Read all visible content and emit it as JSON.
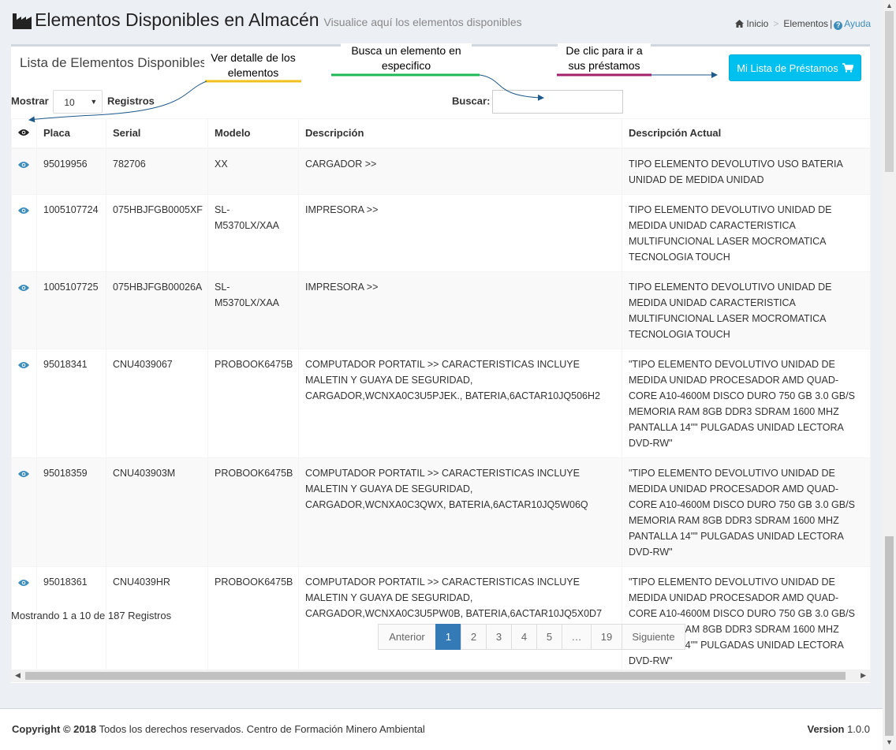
{
  "header": {
    "title": "Elementos Disponibles en Almacén",
    "subtitle": "Visualice aquí los elementos disponibles",
    "breadcrumb": {
      "home": "Inicio",
      "current": "Elementos",
      "help": "Ayuda"
    }
  },
  "box": {
    "title": "Lista de Elementos Disponibles",
    "loans_button": "Mi Lista de Préstamos"
  },
  "controls": {
    "show_label": "Mostrar",
    "show_value": "10",
    "records_label": "Registros",
    "search_label": "Buscar:",
    "search_value": ""
  },
  "table": {
    "columns": [
      "Placa",
      "Serial",
      "Modelo",
      "Descripción",
      "Descripción Actual"
    ],
    "rows": [
      {
        "placa": "95019956",
        "serial": "782706",
        "modelo": "XX",
        "descripcion": "CARGADOR >>",
        "actual": "TIPO ELEMENTO DEVOLUTIVO USO BATERIA UNIDAD DE MEDIDA UNIDAD"
      },
      {
        "placa": "1005107724",
        "serial": "075HBJFGB0005XF",
        "modelo": "SL-M5370LX/XAA",
        "descripcion": "IMPRESORA >>",
        "actual": "TIPO ELEMENTO DEVOLUTIVO UNIDAD DE MEDIDA UNIDAD CARACTERISTICA MULTIFUNCIONAL LASER MOCROMATICA TECNOLOGIA TOUCH"
      },
      {
        "placa": "1005107725",
        "serial": "075HBJFGB00026A",
        "modelo": "SL-M5370LX/XAA",
        "descripcion": "IMPRESORA >>",
        "actual": "TIPO ELEMENTO DEVOLUTIVO UNIDAD DE MEDIDA UNIDAD CARACTERISTICA MULTIFUNCIONAL LASER MOCROMATICA TECNOLOGIA TOUCH"
      },
      {
        "placa": "95018341",
        "serial": "CNU4039067",
        "modelo": "PROBOOK6475B",
        "descripcion": "COMPUTADOR PORTATIL >> CARACTERISTICAS INCLUYE MALETIN Y GUAYA DE SEGURIDAD, CARGADOR,WCNXA0C3U5PJEK., BATERIA,6ACTAR10JQ506H2",
        "actual": "\"TIPO ELEMENTO DEVOLUTIVO UNIDAD DE MEDIDA UNIDAD PROCESADOR AMD QUAD-CORE A10-4600M DISCO DURO 750 GB 3.0 GB/S MEMORIA RAM 8GB DDR3 SDRAM 1600 MHZ PANTALLA 14\"\" PULGADAS UNIDAD LECTORA DVD-RW\""
      },
      {
        "placa": "95018359",
        "serial": "CNU403903M",
        "modelo": "PROBOOK6475B",
        "descripcion": "COMPUTADOR PORTATIL >> CARACTERISTICAS INCLUYE MALETIN Y GUAYA DE SEGURIDAD, CARGADOR,WCNXA0C3QWX, BATERIA,6ACTAR10JQ5W06Q",
        "actual": "\"TIPO ELEMENTO DEVOLUTIVO UNIDAD DE MEDIDA UNIDAD PROCESADOR AMD QUAD-CORE A10-4600M DISCO DURO 750 GB 3.0 GB/S MEMORIA RAM 8GB DDR3 SDRAM 1600 MHZ PANTALLA 14\"\" PULGADAS UNIDAD LECTORA DVD-RW\""
      },
      {
        "placa": "95018361",
        "serial": "CNU4039HR",
        "modelo": "PROBOOK6475B",
        "descripcion": "COMPUTADOR PORTATIL >> CARACTERISTICAS INCLUYE MALETIN Y GUAYA DE SEGURIDAD, CARGADOR,WCNXA0C3U5PW0B, BATERIA,6ACTAR10JQ5X0D7",
        "actual": "\"TIPO ELEMENTO DEVOLUTIVO UNIDAD DE MEDIDA UNIDAD PROCESADOR AMD QUAD-CORE A10-4600M DISCO DURO 750 GB 3.0 GB/S MEMORIA RAM 8GB DDR3 SDRAM 1600 MHZ PANTALLA 14\"\" PULGADAS UNIDAD LECTORA DVD-RW\""
      }
    ]
  },
  "info": "Mostrando 1 a 10 de 187 Registros",
  "pagination": {
    "prev": "Anterior",
    "pages": [
      "1",
      "2",
      "3",
      "4",
      "5",
      "…",
      "19"
    ],
    "active": "1",
    "next": "Siguiente"
  },
  "footer": {
    "copyright_bold": "Copyright © 2018",
    "copyright_text": "Todos los derechos reservados. Centro de Formación Minero Ambiental",
    "version_label": "Version",
    "version_value": "1.0.0"
  },
  "annotations": {
    "detail": "Ver detalle de los elementos",
    "search": "Busca un elemento en especifico",
    "loans": "De clic para ir a sus préstamos"
  },
  "colors": {
    "accent": "#00c0ef",
    "eye_icon": "#3c8dbc",
    "active_page": "#337ab7",
    "note_yellow": "#f2c01e",
    "note_green": "#1db954",
    "note_purple": "#a3206b",
    "arrow_blue": "#1f5a8c"
  },
  "icons": {
    "title": "factory-icon",
    "breadcrumb_home": "home-icon",
    "help": "question-circle-icon",
    "loans": "shopping-cart-icon",
    "view": "eye-icon"
  }
}
